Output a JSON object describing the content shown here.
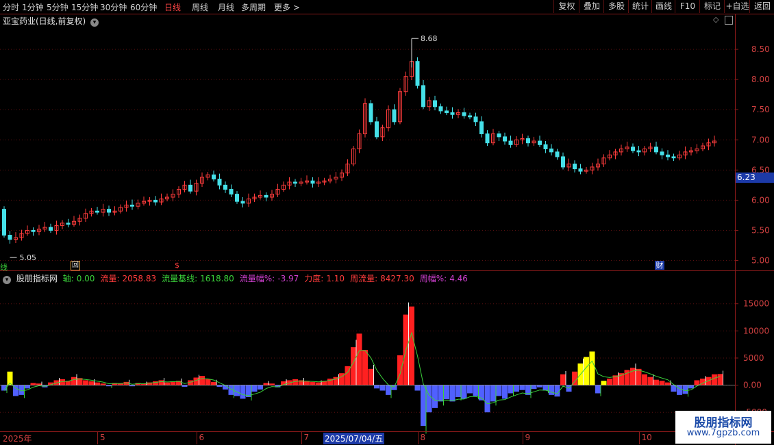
{
  "periods": [
    {
      "label": "分时",
      "active": false
    },
    {
      "label": "1分钟",
      "active": false
    },
    {
      "label": "5分钟",
      "active": false
    },
    {
      "label": "15分钟",
      "active": false
    },
    {
      "label": "30分钟",
      "active": false
    },
    {
      "label": "60分钟",
      "active": false
    },
    {
      "label": "日线",
      "active": true
    },
    {
      "label": "周线",
      "active": false
    },
    {
      "label": "月线",
      "active": false
    },
    {
      "label": "多周期",
      "active": false
    },
    {
      "label": "更多 >",
      "active": false
    }
  ],
  "toolbar": [
    "复权",
    "叠加",
    "多股",
    "统计",
    "画线",
    "F10",
    "标记",
    "+自选",
    "返回"
  ],
  "stock_title": "亚宝药业(日线,前复权)",
  "current_price": "6.23",
  "markers": {
    "left": "线",
    "box": "回",
    "red": "$",
    "right": "财"
  },
  "indicator": {
    "name": "股朋指标网",
    "items": [
      {
        "label": "轴:",
        "value": "0.00",
        "color": "#3ad13a"
      },
      {
        "label": "流量:",
        "value": "2058.83",
        "color": "#ff3c3c"
      },
      {
        "label": "流量基线:",
        "value": "1618.80",
        "color": "#3ad13a"
      },
      {
        "label": "流量幅%:",
        "value": "-3.97",
        "color": "#d040d0"
      },
      {
        "label": "力度:",
        "value": "1.10",
        "color": "#ff3c3c"
      },
      {
        "label": "周流量:",
        "value": "8427.30",
        "color": "#ff3c3c"
      },
      {
        "label": "周幅%:",
        "value": "4.46",
        "color": "#d040d0"
      }
    ]
  },
  "watermark": {
    "title": "股朋指标网",
    "url": "www.7gpzb.com"
  },
  "chart_data": [
    {
      "type": "candlestick",
      "price_axis": {
        "ticks": [
          "8.50",
          "8.00",
          "7.50",
          "7.00",
          "6.50",
          "6.00",
          "5.50",
          "5.00"
        ],
        "range": [
          4.87,
          9.0
        ]
      },
      "annotations": {
        "high": {
          "value": 8.68,
          "label": "8.68"
        },
        "low": {
          "value": 5.05,
          "label": "5.05"
        }
      },
      "closes": [
        5.42,
        5.35,
        5.38,
        5.45,
        5.5,
        5.48,
        5.52,
        5.55,
        5.5,
        5.58,
        5.62,
        5.6,
        5.65,
        5.7,
        5.78,
        5.82,
        5.8,
        5.85,
        5.8,
        5.82,
        5.88,
        5.92,
        5.9,
        5.95,
        5.98,
        6.0,
        5.97,
        6.02,
        6.05,
        6.1,
        6.18,
        6.25,
        6.15,
        6.28,
        6.38,
        6.42,
        6.35,
        6.25,
        6.18,
        6.1,
        5.98,
        5.95,
        6.02,
        6.05,
        6.08,
        6.05,
        6.1,
        6.18,
        6.25,
        6.3,
        6.28,
        6.3,
        6.32,
        6.28,
        6.3,
        6.32,
        6.35,
        6.38,
        6.45,
        6.6,
        6.85,
        7.1,
        7.6,
        7.3,
        7.05,
        7.2,
        7.5,
        7.3,
        7.8,
        8.05,
        8.3,
        7.9,
        7.55,
        7.65,
        7.55,
        7.48,
        7.45,
        7.42,
        7.45,
        7.4,
        7.38,
        7.3,
        7.1,
        6.95,
        7.1,
        7.05,
        6.98,
        6.92,
        7.0,
        7.02,
        6.95,
        6.98,
        6.92,
        6.85,
        6.8,
        6.72,
        6.55,
        6.6,
        6.52,
        6.48,
        6.5,
        6.55,
        6.6,
        6.7,
        6.75,
        6.8,
        6.85,
        6.88,
        6.82,
        6.8,
        6.85,
        6.88,
        6.8,
        6.75,
        6.72,
        6.7,
        6.75,
        6.8,
        6.82,
        6.85,
        6.9,
        6.95,
        6.98
      ],
      "volume_axis": {
        "ticks": [
          "15000",
          "10000",
          "5000",
          "0.00",
          "-5000"
        ],
        "range": [
          -8000,
          19000
        ]
      },
      "flow": [
        -1000,
        2500,
        -2000,
        -1800,
        -600,
        400,
        300,
        -400,
        500,
        900,
        1100,
        800,
        1500,
        1300,
        900,
        700,
        500,
        300,
        -200,
        400,
        300,
        600,
        -200,
        400,
        300,
        500,
        700,
        900,
        500,
        700,
        800,
        -300,
        900,
        1400,
        1700,
        1100,
        600,
        -300,
        -800,
        -1800,
        -2000,
        -2500,
        -2200,
        -1200,
        -800,
        400,
        300,
        -400,
        700,
        900,
        1100,
        900,
        700,
        600,
        500,
        800,
        1200,
        1500,
        2200,
        3500,
        7000,
        9500,
        6500,
        3000,
        -600,
        -1000,
        -1800,
        -900,
        5500,
        13000,
        14500,
        -1000,
        -7500,
        -5000,
        -4200,
        -3000,
        -2600,
        -3000,
        -2200,
        -2500,
        -1500,
        -2000,
        -2800,
        -5000,
        -3000,
        -2000,
        -2500,
        -1500,
        -1200,
        -900,
        -1800,
        -700,
        -400,
        -1000,
        -1800,
        -2100,
        2000,
        -1200,
        2500,
        4000,
        5200,
        6200,
        -1500,
        800,
        1200,
        1800,
        2200,
        2800,
        3200,
        3000,
        2000,
        1500,
        1000,
        800,
        500,
        -1200,
        -1800,
        -1600,
        -600,
        900,
        1200,
        1500,
        2000,
        2058
      ]
    }
  ],
  "time_axis": {
    "labels": [
      {
        "label": "2025年",
        "i": 0
      },
      {
        "label": "5",
        "i": 16
      },
      {
        "label": "6",
        "i": 33
      },
      {
        "label": "7",
        "i": 51
      },
      {
        "label": "2025/07/04/五",
        "i": 54,
        "highlight": true
      },
      {
        "label": "8",
        "i": 71
      },
      {
        "label": "9",
        "i": 89
      },
      {
        "label": "10",
        "i": 109
      }
    ]
  }
}
